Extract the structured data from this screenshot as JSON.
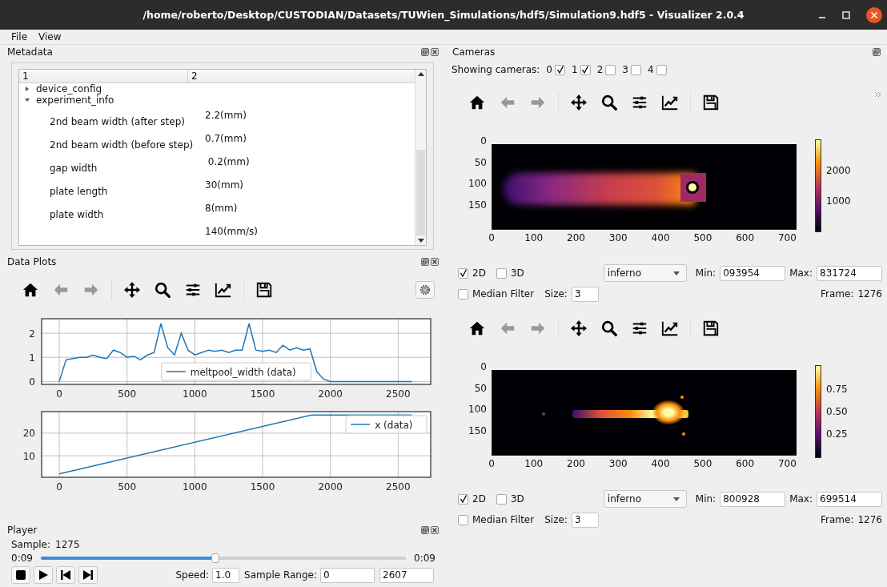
{
  "window": {
    "title": "/home/roberto/Desktop/CUSTODIAN/Datasets/TUWien_Simulations/hdf5/Simulation9.hdf5 - Visualizer 2.0.4"
  },
  "menu": [
    "File",
    "View"
  ],
  "metadata": {
    "title": "Metadata",
    "columns": [
      "1",
      "2"
    ],
    "tree": [
      {
        "label": "device_config",
        "expanded": false
      },
      {
        "label": "experiment_info",
        "expanded": true,
        "children": [
          {
            "label": "2nd beam width (after step)",
            "value": "2.2(mm)"
          },
          {
            "label": "2nd beam width (before step)",
            "value": "0.7(mm)"
          },
          {
            "label": "gap width",
            "value": " 0.2(mm)"
          },
          {
            "label": "plate length",
            "value": "30(mm)"
          },
          {
            "label": "plate width",
            "value": "8(mm)"
          },
          {
            "value": "140(mm/s)"
          }
        ]
      }
    ]
  },
  "data_plots": {
    "title": "Data Plots",
    "toolbar": [
      {
        "kind": "home",
        "disabled": false
      },
      {
        "kind": "back",
        "disabled": true
      },
      {
        "kind": "forward",
        "disabled": true
      },
      {
        "kind": "pan",
        "disabled": false
      },
      {
        "kind": "zoom",
        "disabled": false
      },
      {
        "kind": "configure",
        "disabled": false
      },
      {
        "kind": "axes",
        "disabled": false
      },
      {
        "kind": "save",
        "disabled": false
      },
      {
        "kind": "settings"
      }
    ],
    "plots": [
      {
        "chart_data": {
          "type": "line",
          "grid": true,
          "x": [
            0,
            50,
            100,
            150,
            200,
            250,
            300,
            350,
            400,
            450,
            500,
            550,
            600,
            650,
            700,
            750,
            800,
            850,
            900,
            950,
            1000,
            1050,
            1100,
            1150,
            1200,
            1250,
            1300,
            1350,
            1400,
            1450,
            1500,
            1550,
            1600,
            1650,
            1700,
            1750,
            1800,
            1850,
            1900,
            1950,
            2000,
            2050,
            2100,
            2150,
            2200,
            2250,
            2300,
            2350,
            2400,
            2450,
            2500,
            2550,
            2600
          ],
          "series": [
            {
              "name": "meltpool_width (data)",
              "color": "#1f77b4",
              "values": [
                0,
                0.9,
                0.95,
                1.0,
                1.0,
                1.1,
                1.0,
                0.95,
                1.3,
                1.2,
                1.0,
                1.05,
                0.9,
                1.1,
                1.2,
                2.4,
                1.4,
                1.1,
                2.0,
                1.3,
                1.1,
                1.2,
                1.3,
                1.25,
                1.3,
                1.2,
                1.3,
                1.3,
                2.4,
                1.3,
                1.25,
                1.3,
                1.2,
                1.5,
                1.3,
                1.4,
                1.3,
                1.35,
                0.4,
                0.1,
                0,
                0,
                0,
                0,
                0,
                0,
                0,
                0,
                0,
                0,
                0,
                0,
                0
              ]
            }
          ],
          "xlim": [
            -130,
            2740
          ],
          "ylim": [
            -0.12,
            2.6
          ],
          "xticks": [
            0,
            500,
            1000,
            1500,
            2000,
            2500
          ],
          "yticks": [
            0,
            1,
            2
          ]
        }
      },
      {
        "chart_data": {
          "type": "line",
          "grid": true,
          "x": [
            0,
            1860,
            2600
          ],
          "series": [
            {
              "name": "x (data)",
              "color": "#1f77b4",
              "values": [
                2,
                28,
                28
              ]
            }
          ],
          "xlim": [
            -130,
            2740
          ],
          "ylim": [
            0.5,
            29.5
          ],
          "xticks": [
            0,
            500,
            1000,
            1500,
            2000,
            2500
          ],
          "yticks": [
            10,
            20
          ]
        }
      }
    ]
  },
  "cameras": {
    "title": "Cameras",
    "showing_label": "Showing cameras:",
    "cameras": [
      {
        "label": "0",
        "checked": true
      },
      {
        "label": "1",
        "checked": true
      },
      {
        "label": "2",
        "checked": false
      },
      {
        "label": "3",
        "checked": false
      },
      {
        "label": "4",
        "checked": false
      }
    ],
    "views": [
      {
        "toolbar": [
          {
            "kind": "home",
            "disabled": false
          },
          {
            "kind": "back",
            "disabled": true
          },
          {
            "kind": "forward",
            "disabled": true
          },
          {
            "kind": "pan",
            "disabled": false
          },
          {
            "kind": "zoom",
            "disabled": false
          },
          {
            "kind": "configure",
            "disabled": false
          },
          {
            "kind": "axes",
            "disabled": false
          },
          {
            "kind": "save",
            "disabled": false
          },
          {
            "kind": "overflow"
          }
        ],
        "image": {
          "kind": "smooth",
          "yticks": [
            "0",
            "50",
            "100",
            "150"
          ],
          "xticks": [
            "0",
            "100",
            "200",
            "300",
            "400",
            "500",
            "600",
            "700"
          ],
          "colorbar": [
            "2000",
            "1000"
          ]
        },
        "mode_2d": {
          "label": "2D",
          "checked": true
        },
        "mode_3d": {
          "label": "3D",
          "checked": false
        },
        "colormap": "inferno",
        "min_label": "Min:",
        "min": "093954",
        "max_label": "Max:",
        "max": "831724",
        "median_filter": {
          "label": "Median Filter",
          "checked": false
        },
        "size_label": "Size:",
        "size": "3",
        "frame_label": "Frame:",
        "frame": "1276"
      },
      {
        "toolbar": [
          {
            "kind": "home",
            "disabled": false
          },
          {
            "kind": "back",
            "disabled": true
          },
          {
            "kind": "forward",
            "disabled": true
          },
          {
            "kind": "pan",
            "disabled": false
          },
          {
            "kind": "zoom",
            "disabled": false
          },
          {
            "kind": "configure",
            "disabled": false
          },
          {
            "kind": "axes",
            "disabled": false
          },
          {
            "kind": "save",
            "disabled": false
          }
        ],
        "image": {
          "kind": "speckled",
          "yticks": [
            "0",
            "50",
            "100",
            "150"
          ],
          "xticks": [
            "0",
            "100",
            "200",
            "300",
            "400",
            "500",
            "600",
            "700"
          ],
          "colorbar": [
            "0.75",
            "0.50",
            "0.25"
          ]
        },
        "mode_2d": {
          "label": "2D",
          "checked": true
        },
        "mode_3d": {
          "label": "3D",
          "checked": false
        },
        "colormap": "inferno",
        "min_label": "Min:",
        "min": "800928",
        "max_label": "Max:",
        "max": "699514",
        "median_filter": {
          "label": "Median Filter",
          "checked": false
        },
        "size_label": "Size:",
        "size": "3",
        "frame_label": "Frame:",
        "frame": "1276"
      }
    ]
  },
  "player": {
    "title": "Player",
    "sample_label": "Sample:",
    "sample": "1275",
    "time_start": "0:09",
    "time_end": "0:09",
    "position": {
      "level": 0.49
    },
    "buttons": [
      {
        "kind": "stop"
      },
      {
        "kind": "play"
      },
      {
        "kind": "previous"
      },
      {
        "kind": "next"
      }
    ],
    "speed_label": "Speed:",
    "speed": "1.0",
    "range_label": "Sample Range:",
    "range_from": "0",
    "range_to": "2607"
  }
}
